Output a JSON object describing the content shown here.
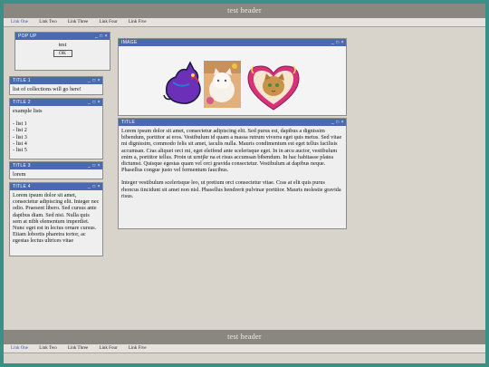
{
  "header": {
    "title": "test header"
  },
  "nav": {
    "links": [
      "Link One",
      "Link Two",
      "Link Three",
      "Link Four",
      "Link Five"
    ]
  },
  "popup": {
    "title": "POP UP",
    "message": "test",
    "ok_label": "OK"
  },
  "window_controls": "_ □ ×",
  "windows": {
    "title1": {
      "title": "TITLE 1",
      "text": "list of collections will go here!"
    },
    "title2": {
      "title": "TITLE 2",
      "heading": "example lists",
      "items": [
        "- list 1",
        "- list 2",
        "- list 3",
        "- list 4",
        "- list 5"
      ]
    },
    "title3": {
      "title": "TITLE 3",
      "text": "lorem"
    },
    "title4": {
      "title": "TITLE 4",
      "text": "Lorem ipsum dolor sit amet, consectetur adipiscing elit. Integer nec odio. Praesent libero. Sed cursus ante dapibus diam. Sed nisi. Nulla quis sem at nibh elementum imperdiet. Nunc eget est in lectus ornare cursus. Etiam lobortis pharetra tortor, ac egestas lectus ultrices vitae"
    }
  },
  "image_window": {
    "title": "IMAGE",
    "images": [
      "purple-cat-sticker-icon",
      "kitten-photo-icon",
      "cat-heart-frame-icon"
    ]
  },
  "text_window": {
    "title": "TITLE",
    "paragraph1": "Lorem ipsum dolor sit amet, consectetur adipiscing elit. Sed purus est, dapibus a dignissim bibendum, porttitor at eros. Vestibulum id quam a massa rutrum viverra eget quis metus. Sed vitae mi dignissim, commodo felis sit amet, iaculis nulla. Mauris condimentum est eget tellus facilisis accumsan. Cras aliquet orci mi, eget eleifend ante scelerisque eget. In in arcu auctor, vestibulum enim a, porttitor tellus. Proin ut urntjkr na et risus accumsan bibendum. In hac habitasse platea dictumst. Quisque egestas quam vel orci gravida consectetur. Vestibulum at dapibus neque. Phasellus congue justo vel fermentum faucibus.",
    "paragraph2": "Integer vestibulum scelerisque leo, ut pretium orci consectetur vitae. Cras at elit quis purus rhoncus tincidunt sit amet non nisl. Phasellus hendrerit pulvinar porttitor. Mauris molestie gravida risus."
  },
  "footer": {
    "title": "test header"
  },
  "colors": {
    "frame_border": "#3a8f86",
    "header_bg": "#8a8780",
    "titlebar_bg": "#4a6ab0",
    "page_bg": "#d8d3cb"
  }
}
